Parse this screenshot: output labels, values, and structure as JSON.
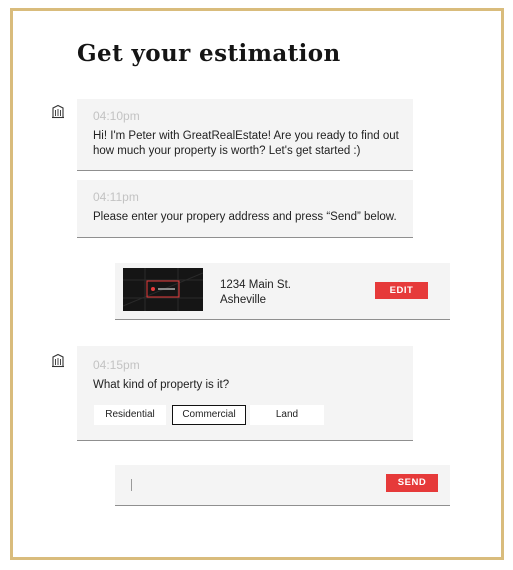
{
  "page": {
    "title": "Get your estimation"
  },
  "messages": [
    {
      "time": "04:10pm",
      "line1": "Hi! I'm Peter with GreatRealEstate! Are you ready to find out",
      "line2": "how much your property is worth? Let's get started :)"
    },
    {
      "time": "04:11pm",
      "text": "Please enter your propery address and press “Send” below."
    },
    {
      "time": "04:15pm",
      "text": "What kind of property is it?"
    }
  ],
  "address_reply": {
    "line1": "1234 Main St.",
    "line2": "Asheville",
    "edit_label": "EDIT"
  },
  "property_options": [
    {
      "label": "Residential",
      "selected": false
    },
    {
      "label": "Commercial",
      "selected": true
    },
    {
      "label": "Land",
      "selected": false
    }
  ],
  "composer": {
    "value": "",
    "send_label": "SEND"
  },
  "colors": {
    "frame": "#d9bc7c",
    "accent": "#e63a3a",
    "bubble": "#f4f4f4"
  },
  "icons": {
    "agent_avatar": "building-icon"
  }
}
